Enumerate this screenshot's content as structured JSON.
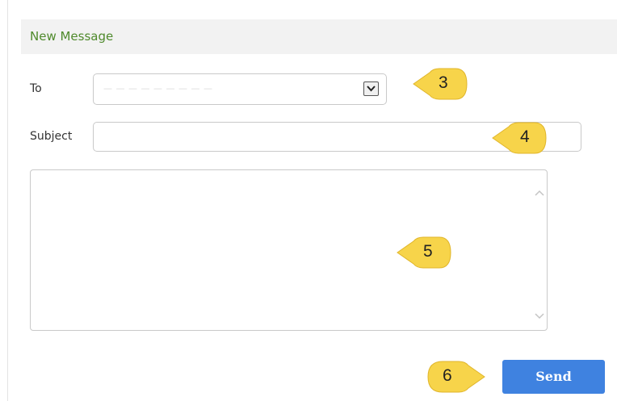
{
  "header": {
    "title": "New Message"
  },
  "to_field": {
    "label": "To",
    "selected_value": "— — — — — — — — —",
    "arrow_icon": "chevron-down-icon"
  },
  "subject_field": {
    "label": "Subject",
    "value": ""
  },
  "message_body": {
    "value": ""
  },
  "send_button": {
    "label": "Send",
    "color": "#3f82e0"
  },
  "callouts": [
    {
      "number": "3",
      "color": "#f7d44a"
    },
    {
      "number": "4",
      "color": "#f7d44a"
    },
    {
      "number": "5",
      "color": "#f7d44a"
    },
    {
      "number": "6",
      "color": "#f7d44a"
    }
  ],
  "colors": {
    "header_text": "#4f8a2c",
    "header_bg": "#f2f2f2"
  }
}
